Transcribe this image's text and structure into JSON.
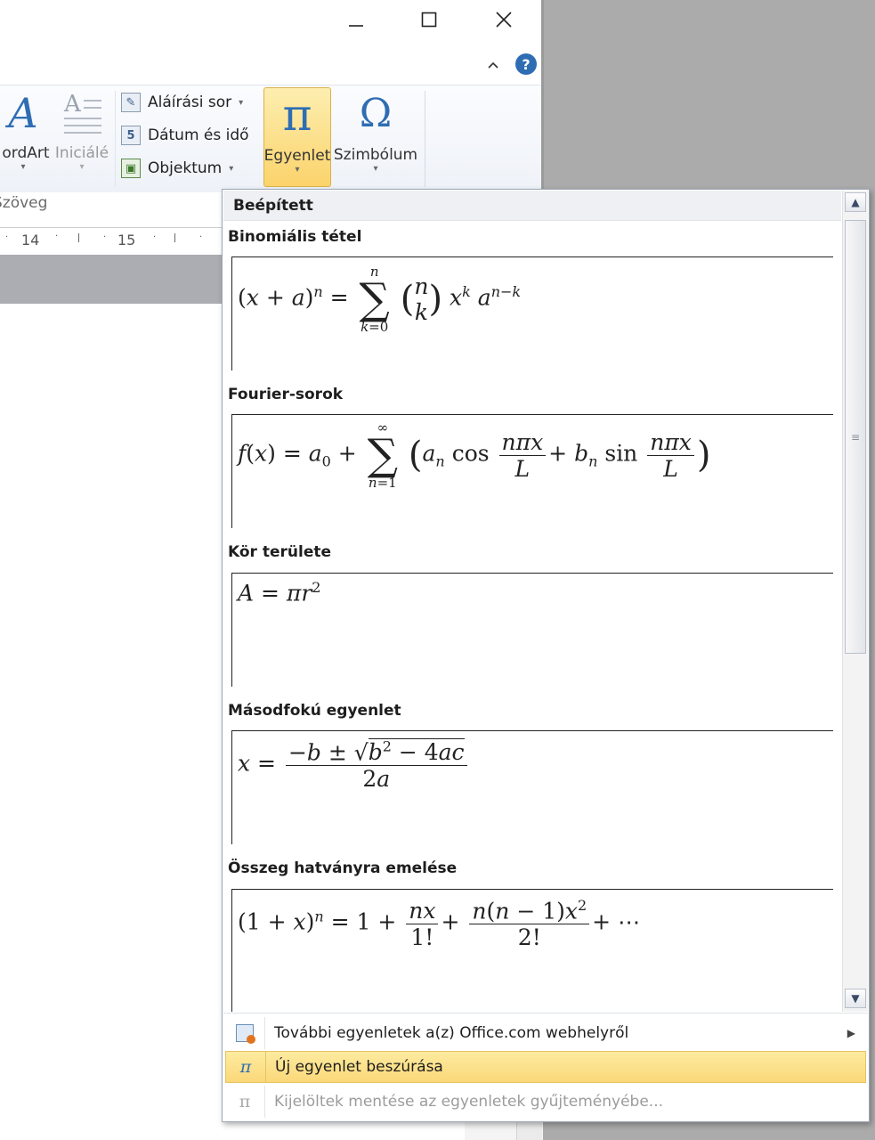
{
  "window": {
    "minimize_icon": "minimize-icon",
    "maximize_icon": "maximize-icon",
    "close_icon": "close-icon",
    "collapse_ribbon_icon": "chevron-up-icon",
    "help_icon": "help-icon",
    "help_glyph": "?"
  },
  "ribbon": {
    "wordart_label": "ordArt",
    "dropcap_label": "Iniciálé",
    "signature_line_label": "Aláírási sor",
    "datetime_label": "Dátum és idő",
    "object_label": "Objektum",
    "equation_label": "Egyenlet",
    "equation_glyph": "π",
    "symbol_label": "Szimbólum",
    "symbol_glyph": "Ω",
    "group_label": "Szöveg"
  },
  "ruler": {
    "tick_14": "14",
    "tick_15": "15"
  },
  "gallery": {
    "header": "Beépített",
    "items": [
      {
        "title": "Binomiális tétel"
      },
      {
        "title": "Fourier-sorok"
      },
      {
        "title": "Kör területe"
      },
      {
        "title": "Másodfokú egyenlet"
      },
      {
        "title": "Összeg hatványra emelése"
      }
    ]
  },
  "menu": {
    "more_equations": "További egyenletek a(z) Office.com webhelyről",
    "insert_new": "Új egyenlet beszúrása",
    "save_selection": "Kijelöltek mentése az egyenletek gyűjteményébe..."
  },
  "colors": {
    "highlight": "#fbd879",
    "window_gray": "#ababab",
    "accent_blue": "#2f6db3"
  }
}
